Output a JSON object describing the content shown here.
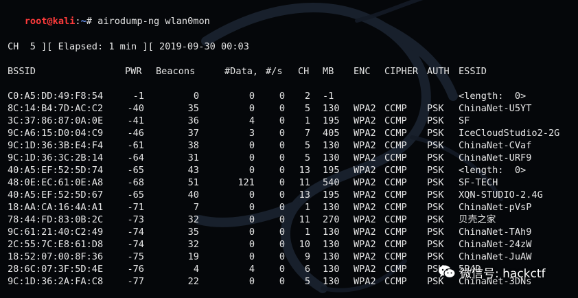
{
  "prompt": {
    "user_host": "root@kali",
    "path": "~",
    "symbol": "#",
    "command": "airodump-ng wlan0mon"
  },
  "status_line": "CH  5 ][ Elapsed: 1 min ][ 2019-09-30 00:03",
  "headers": {
    "bssid": "BSSID",
    "pwr": "PWR",
    "beacons": "Beacons",
    "data": "#Data,",
    "rate": "#/s",
    "ch": "CH",
    "mb": "MB",
    "enc": "ENC",
    "cipher": "CIPHER",
    "auth": "AUTH",
    "essid": "ESSID"
  },
  "rows": [
    {
      "bssid": "C0:A5:DD:49:F8:54",
      "pwr": "-1",
      "beacons": "0",
      "data": "0",
      "rate": "0",
      "ch": "2",
      "mb": "-1",
      "enc": "",
      "cipher": "",
      "auth": "",
      "essid": "<length:  0>"
    },
    {
      "bssid": "8C:14:B4:7D:AC:C2",
      "pwr": "-40",
      "beacons": "35",
      "data": "0",
      "rate": "0",
      "ch": "5",
      "mb": "130",
      "enc": "WPA2",
      "cipher": "CCMP",
      "auth": "PSK",
      "essid": "ChinaNet-U5YT"
    },
    {
      "bssid": "3C:37:86:87:0A:0E",
      "pwr": "-41",
      "beacons": "36",
      "data": "4",
      "rate": "0",
      "ch": "1",
      "mb": "195",
      "enc": "WPA2",
      "cipher": "CCMP",
      "auth": "PSK",
      "essid": "SF"
    },
    {
      "bssid": "9C:A6:15:D0:04:C9",
      "pwr": "-46",
      "beacons": "37",
      "data": "3",
      "rate": "0",
      "ch": "7",
      "mb": "405",
      "enc": "WPA2",
      "cipher": "CCMP",
      "auth": "PSK",
      "essid": "IceCloudStudio2-2G"
    },
    {
      "bssid": "9C:1D:36:3B:E4:F4",
      "pwr": "-61",
      "beacons": "38",
      "data": "0",
      "rate": "0",
      "ch": "5",
      "mb": "130",
      "enc": "WPA2",
      "cipher": "CCMP",
      "auth": "PSK",
      "essid": "ChinaNet-CVaf"
    },
    {
      "bssid": "9C:1D:36:3C:2B:14",
      "pwr": "-64",
      "beacons": "31",
      "data": "0",
      "rate": "0",
      "ch": "5",
      "mb": "130",
      "enc": "WPA2",
      "cipher": "CCMP",
      "auth": "PSK",
      "essid": "ChinaNet-URF9"
    },
    {
      "bssid": "40:A5:EF:52:5D:74",
      "pwr": "-65",
      "beacons": "43",
      "data": "0",
      "rate": "0",
      "ch": "13",
      "mb": "195",
      "enc": "WPA2",
      "cipher": "CCMP",
      "auth": "PSK",
      "essid": "<length:  0>"
    },
    {
      "bssid": "48:0E:EC:61:0E:A8",
      "pwr": "-68",
      "beacons": "51",
      "data": "121",
      "rate": "0",
      "ch": "11",
      "mb": "540",
      "enc": "WPA2",
      "cipher": "CCMP",
      "auth": "PSK",
      "essid": "SF-TECH"
    },
    {
      "bssid": "40:A5:EF:52:5D:67",
      "pwr": "-65",
      "beacons": "40",
      "data": "0",
      "rate": "0",
      "ch": "13",
      "mb": "195",
      "enc": "WPA2",
      "cipher": "CCMP",
      "auth": "PSK",
      "essid": "XQN-STUDIO-2.4G"
    },
    {
      "bssid": "18:AA:CA:16:4A:A1",
      "pwr": "-71",
      "beacons": "7",
      "data": "0",
      "rate": "0",
      "ch": "1",
      "mb": "130",
      "enc": "WPA2",
      "cipher": "CCMP",
      "auth": "PSK",
      "essid": "ChinaNet-pVsP"
    },
    {
      "bssid": "78:44:FD:83:0B:2C",
      "pwr": "-73",
      "beacons": "32",
      "data": "0",
      "rate": "0",
      "ch": "11",
      "mb": "270",
      "enc": "WPA2",
      "cipher": "CCMP",
      "auth": "PSK",
      "essid": "贝壳之家"
    },
    {
      "bssid": "9C:61:21:40:C2:49",
      "pwr": "-74",
      "beacons": "35",
      "data": "0",
      "rate": "0",
      "ch": "1",
      "mb": "130",
      "enc": "WPA2",
      "cipher": "CCMP",
      "auth": "PSK",
      "essid": "ChinaNet-TAh9"
    },
    {
      "bssid": "2C:55:7C:E8:61:D8",
      "pwr": "-74",
      "beacons": "32",
      "data": "0",
      "rate": "0",
      "ch": "10",
      "mb": "130",
      "enc": "WPA2",
      "cipher": "CCMP",
      "auth": "PSK",
      "essid": "ChinaNet-24zW"
    },
    {
      "bssid": "18:52:07:00:8F:36",
      "pwr": "-75",
      "beacons": "19",
      "data": "0",
      "rate": "0",
      "ch": "9",
      "mb": "130",
      "enc": "WPA2",
      "cipher": "CCMP",
      "auth": "PSK",
      "essid": "ChinaNet-JuAW"
    },
    {
      "bssid": "28:6C:07:3F:5D:4E",
      "pwr": "-76",
      "beacons": "4",
      "data": "4",
      "rate": "0",
      "ch": "6",
      "mb": "130",
      "enc": "WPA2",
      "cipher": "CCMP",
      "auth": "PSK",
      "essid": "5P4D"
    },
    {
      "bssid": "9C:1D:36:2A:FA:C8",
      "pwr": "-77",
      "beacons": "22",
      "data": "0",
      "rate": "0",
      "ch": "5",
      "mb": "130",
      "enc": "WPA2",
      "cipher": "CCMP",
      "auth": "PSK",
      "essid": "ChinaNet-3DNs"
    }
  ],
  "watermark": {
    "text": "微信号: hackctf",
    "icon": "wechat-icon"
  },
  "colors": {
    "background": "#05070a",
    "text": "#e6e6e6",
    "prompt_user": "#ff3b3b",
    "prompt_path": "#6f9cff"
  }
}
